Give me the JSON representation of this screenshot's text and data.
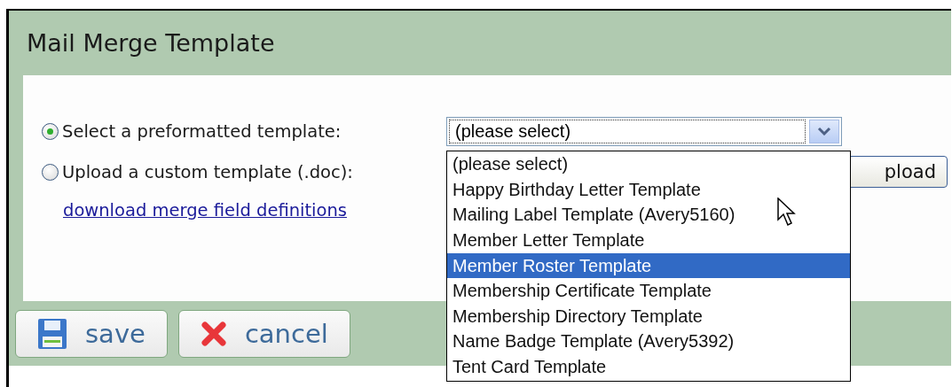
{
  "title": "Mail Merge Template",
  "options": [
    {
      "label": "Select a preformatted template:",
      "selected": true
    },
    {
      "label": "Upload a custom template (.doc):",
      "selected": false
    }
  ],
  "template_select": {
    "value": "(please select)",
    "expanded": true,
    "items": [
      {
        "label": "(please select)",
        "highlighted": false
      },
      {
        "label": "Happy Birthday Letter Template",
        "highlighted": false
      },
      {
        "label": "Mailing Label Template (Avery5160)",
        "highlighted": false
      },
      {
        "label": "Member Letter Template",
        "highlighted": false
      },
      {
        "label": "Member Roster Template",
        "highlighted": true
      },
      {
        "label": "Membership Certificate Template",
        "highlighted": false
      },
      {
        "label": "Membership Directory Template",
        "highlighted": false
      },
      {
        "label": "Name Badge Template (Avery5392)",
        "highlighted": false
      },
      {
        "label": "Tent Card Template",
        "highlighted": false
      }
    ]
  },
  "upload_button": "pload",
  "link": "download merge field definitions",
  "buttons": [
    {
      "kind": "save",
      "label": "save"
    },
    {
      "kind": "cancel",
      "label": "cancel"
    }
  ]
}
